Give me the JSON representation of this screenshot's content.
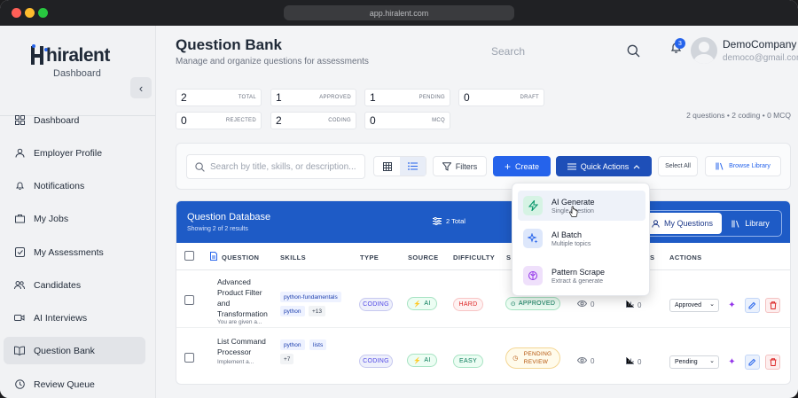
{
  "browser": {
    "url": "app.hiralent.com"
  },
  "brand": {
    "name": "hiralent",
    "section": "Dashboard"
  },
  "sidebar": {
    "items": [
      {
        "label": "Dashboard",
        "icon": "grid-icon"
      },
      {
        "label": "Employer Profile",
        "icon": "user-icon"
      },
      {
        "label": "Notifications",
        "icon": "bell-icon"
      },
      {
        "label": "My Jobs",
        "icon": "briefcase-icon"
      },
      {
        "label": "My Assessments",
        "icon": "checkbox-icon"
      },
      {
        "label": "Candidates",
        "icon": "users-icon"
      },
      {
        "label": "AI Interviews",
        "icon": "video-icon"
      },
      {
        "label": "Question Bank",
        "icon": "book-icon",
        "active": true
      },
      {
        "label": "Review Queue",
        "icon": "clock-icon"
      }
    ]
  },
  "header": {
    "title": "Question Bank",
    "subtitle": "Manage and organize questions for assessments",
    "search_placeholder": "Search",
    "notification_count": "3",
    "user_name": "DemoCompany",
    "user_email": "democo@gmail.com"
  },
  "stats": [
    {
      "value": "2",
      "label": "TOTAL"
    },
    {
      "value": "1",
      "label": "APPROVED"
    },
    {
      "value": "1",
      "label": "PENDING"
    },
    {
      "value": "0",
      "label": "DRAFT"
    },
    {
      "value": "0",
      "label": "REJECTED"
    },
    {
      "value": "2",
      "label": "CODING"
    },
    {
      "value": "0",
      "label": "MCQ"
    }
  ],
  "summary": "2 questions • 2 coding • 0 MCQ",
  "toolbar": {
    "search_placeholder": "Search by title, skills, or description...",
    "filters": "Filters",
    "create": "Create",
    "quick_actions": "Quick Actions",
    "select_all": "Select All",
    "browse_library": "Browse Library"
  },
  "quick_actions_menu": [
    {
      "title": "AI Generate",
      "subtitle": "Single question",
      "icon": "lightning-icon",
      "color": "#059669"
    },
    {
      "title": "AI Batch",
      "subtitle": "Multiple topics",
      "icon": "sparkles-icon",
      "color": "#2563eb"
    },
    {
      "title": "Pattern Scrape",
      "subtitle": "Extract & generate",
      "icon": "brain-icon",
      "color": "#9333ea"
    }
  ],
  "table": {
    "title": "Question Database",
    "subtitle": "Showing 2 of 2 results",
    "total": "2 Total",
    "tab_mine": "My Questions",
    "tab_library": "Library",
    "columns": [
      "QUESTION",
      "SKILLS",
      "TYPE",
      "SOURCE",
      "DIFFICULTY",
      "S",
      "S",
      "ACTIONS"
    ],
    "rows": [
      {
        "title": "Advanced Product Filter and Transformation",
        "preview": "You are given a...",
        "skills": [
          "python-fundamentals",
          "python",
          "+13"
        ],
        "type": "CODING",
        "source": "AI",
        "difficulty": "HARD",
        "status": "APPROVED",
        "views": "0",
        "uses": "0",
        "action_status": "Approved"
      },
      {
        "title": "List Command Processor",
        "preview": "Implement a...",
        "skills": [
          "python",
          "lists",
          "+7"
        ],
        "type": "CODING",
        "source": "AI",
        "difficulty": "EASY",
        "status": "PENDING REVIEW",
        "views": "0",
        "uses": "0",
        "action_status": "Pending"
      }
    ]
  }
}
